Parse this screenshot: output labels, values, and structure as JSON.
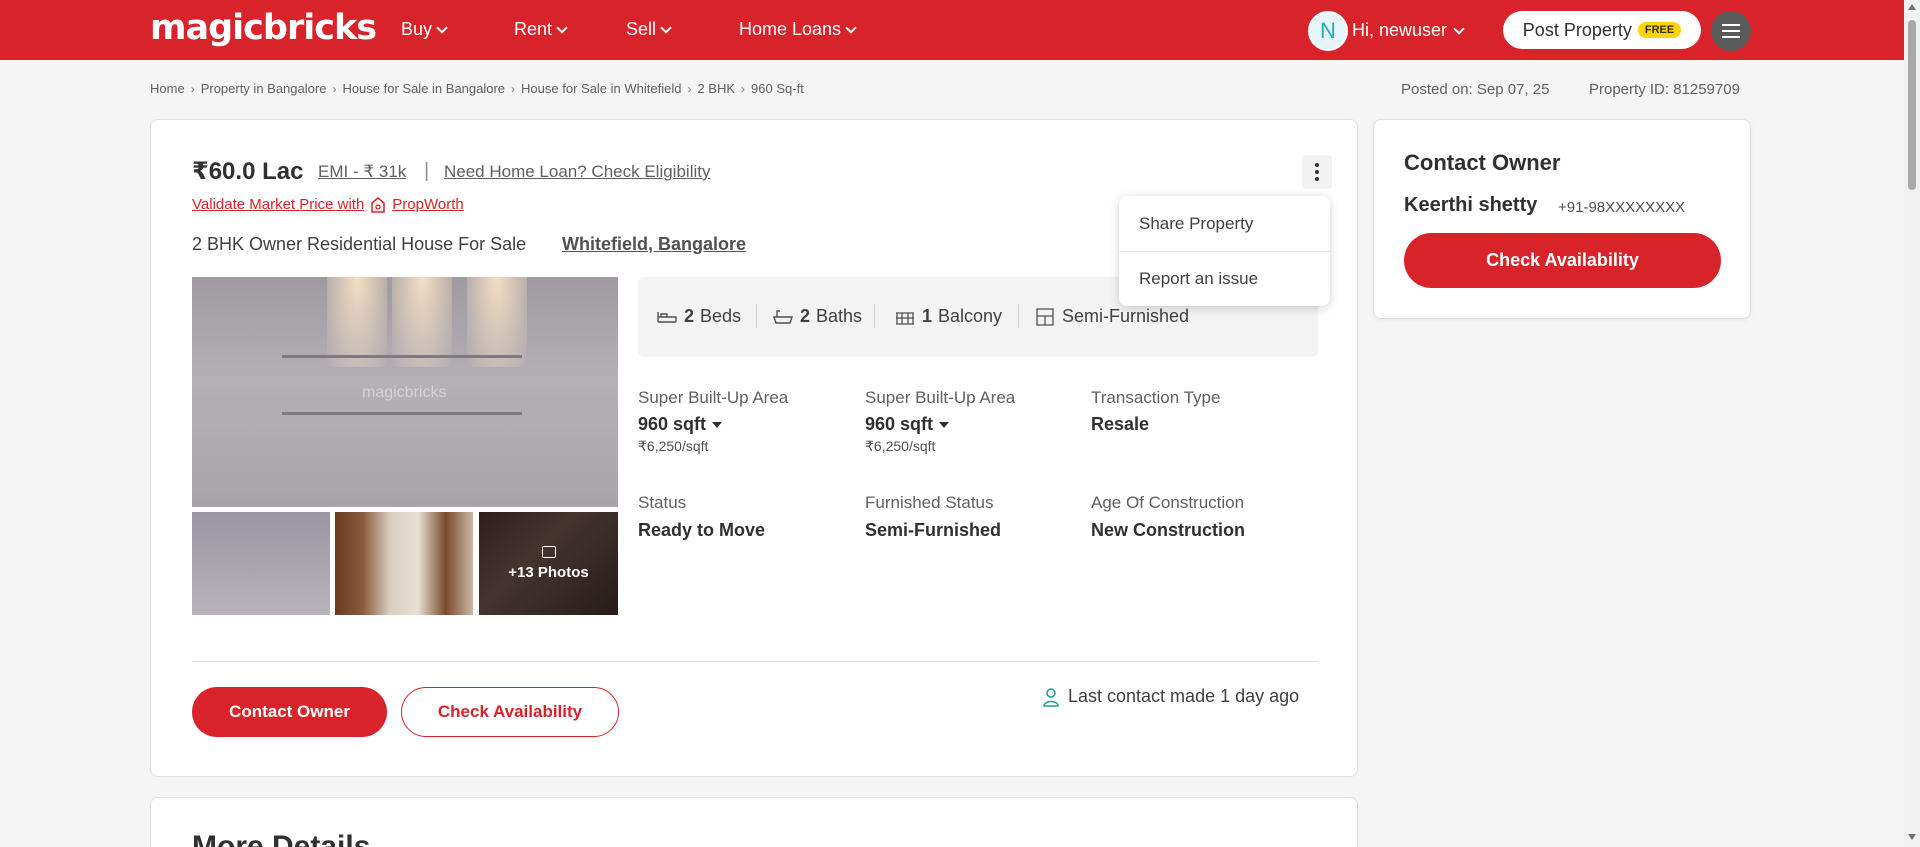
{
  "header": {
    "logo": "magicbricks",
    "nav": [
      {
        "label": "Buy"
      },
      {
        "label": "Rent"
      },
      {
        "label": "Sell"
      },
      {
        "label": "Home Loans"
      }
    ],
    "avatar_initial": "N",
    "greeting": "Hi, newuser",
    "post_property": "Post Property",
    "free_badge": "FREE"
  },
  "breadcrumb": [
    "Home",
    "Property in Bangalore",
    "House for Sale in Bangalore",
    "House for Sale in Whitefield",
    "2 BHK",
    "960 Sq-ft"
  ],
  "meta": {
    "posted_on": "Posted on: Sep 07, 25",
    "property_id": "Property ID: 81259709"
  },
  "listing": {
    "price": "₹60.0 Lac",
    "emi": "EMI - ₹ 31k",
    "separator": "|",
    "home_loan_link": "Need Home Loan? Check Eligibility",
    "validate_price": "Validate Market Price with",
    "propworth": "PropWorth",
    "title": "2 BHK Owner Residential House For Sale",
    "location": "Whitefield, Bangalore",
    "photo_watermark": "magicbricks",
    "photo_count": "+13 Photos",
    "features": [
      {
        "value": "2",
        "label": "Beds"
      },
      {
        "value": "2",
        "label": "Baths"
      },
      {
        "value": "1",
        "label": "Balcony"
      },
      {
        "value": "",
        "label": "Semi-Furnished"
      }
    ],
    "menu": {
      "share": "Share Property",
      "report": "Report an issue"
    },
    "details": [
      {
        "label": "Super Built-Up Area",
        "value": "960 sqft",
        "sub": "₹6,250/sqft"
      },
      {
        "label": "Super Built-Up Area",
        "value": "960 sqft",
        "sub": "₹6,250/sqft"
      },
      {
        "label": "Transaction Type",
        "value": "Resale"
      },
      {
        "label": "Status",
        "value": "Ready to Move"
      },
      {
        "label": "Furnished Status",
        "value": "Semi-Furnished"
      },
      {
        "label": "Age Of Construction",
        "value": "New Construction"
      }
    ],
    "contact_owner_btn": "Contact Owner",
    "check_availability_btn": "Check Availability",
    "last_contact": "Last contact made 1 day ago"
  },
  "side": {
    "title": "Contact Owner",
    "owner_name": "Keerthi shetty",
    "owner_phone": "+91-98XXXXXXXX",
    "button": "Check Availability"
  },
  "more_details": {
    "title": "More Details"
  },
  "colors": {
    "brand": "#d8232a",
    "badge": "#ffd400"
  }
}
